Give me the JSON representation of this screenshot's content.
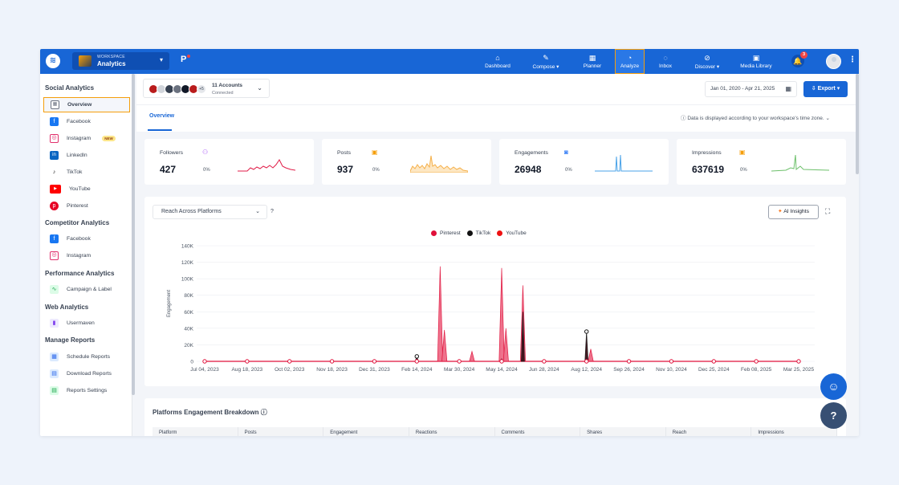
{
  "workspace": {
    "label": "WORKSPACE",
    "name": "Analytics"
  },
  "nav": [
    {
      "label": "Dashboard",
      "icon": "home-icon"
    },
    {
      "label": "Compose",
      "icon": "pen-icon"
    },
    {
      "label": "Planner",
      "icon": "calendar-icon"
    },
    {
      "label": "Analyze",
      "icon": "analyze-icon"
    },
    {
      "label": "Inbox",
      "icon": "chat-icon"
    },
    {
      "label": "Discover",
      "icon": "compass-icon"
    },
    {
      "label": "Media Library",
      "icon": "image-icon"
    }
  ],
  "notifications_count": "3",
  "sidebar": {
    "sections": [
      {
        "title": "Social Analytics",
        "items": [
          "Overview",
          "Facebook",
          "Instagram",
          "LinkedIn",
          "TikTok",
          "YouTube",
          "Pinterest"
        ]
      },
      {
        "title": "Competitor Analytics",
        "items": [
          "Facebook",
          "Instagram"
        ]
      },
      {
        "title": "Performance Analytics",
        "items": [
          "Campaign & Label"
        ]
      },
      {
        "title": "Web Analytics",
        "items": [
          "Usermaven"
        ]
      },
      {
        "title": "Manage Reports",
        "items": [
          "Schedule Reports",
          "Download Reports",
          "Reports Settings"
        ]
      }
    ],
    "new_badge": "NEW"
  },
  "accounts": {
    "count_label": "11 Accounts",
    "status": "Connected",
    "extra": "+5"
  },
  "date_range": "Jan 01, 2020 - Apr 21, 2025",
  "export_label": "Export",
  "tab": "Overview",
  "timezone_note": "Data is displayed according to your workspace's time zone.",
  "stats": [
    {
      "label": "Followers",
      "value": "427",
      "pct": "0%",
      "color": "#e11d48"
    },
    {
      "label": "Posts",
      "value": "937",
      "pct": "0%",
      "color": "#f5b04a"
    },
    {
      "label": "Engagements",
      "value": "26948",
      "pct": "0%",
      "color": "#4aa3e8"
    },
    {
      "label": "Impressions",
      "value": "637619",
      "pct": "0%",
      "color": "#6cc06a"
    }
  ],
  "chart_select": "Reach Across Platforms",
  "ai_insights": "AI Insights",
  "chart_data": {
    "type": "area",
    "ylabel": "Engagement",
    "ylim": [
      0,
      140000
    ],
    "yticks": [
      "0",
      "20K",
      "40K",
      "60K",
      "80K",
      "100K",
      "120K",
      "140K"
    ],
    "xticks": [
      "Jul 04, 2023",
      "Aug 18, 2023",
      "Oct 02, 2023",
      "Nov 18, 2023",
      "Dec 31, 2023",
      "Feb 14, 2024",
      "Mar 30, 2024",
      "May 14, 2024",
      "Jun 28, 2024",
      "Aug 12, 2024",
      "Sep 26, 2024",
      "Nov 10, 2024",
      "Dec 25, 2024",
      "Feb 08, 2025",
      "Mar 25, 2025"
    ],
    "series": [
      {
        "name": "Pinterest",
        "color": "#e0103a",
        "peaks": [
          [
            5.55,
            115000
          ],
          [
            5.65,
            38000
          ],
          [
            6.3,
            12000
          ],
          [
            7.0,
            113000
          ],
          [
            7.1,
            40000
          ],
          [
            7.5,
            92000
          ],
          [
            9.1,
            15000
          ]
        ]
      },
      {
        "name": "TikTok",
        "color": "#111111",
        "peaks": [
          [
            5.0,
            6000
          ],
          [
            7.0,
            3000
          ],
          [
            7.5,
            60000
          ],
          [
            9.0,
            36000
          ]
        ]
      },
      {
        "name": "YouTube",
        "color": "#ee1111",
        "peaks": []
      }
    ]
  },
  "breakdown": {
    "title": "Platforms Engagement Breakdown",
    "columns": [
      "Platform",
      "Posts",
      "Engagement",
      "Reactions",
      "Comments",
      "Shares",
      "Reach",
      "Impressions"
    ]
  }
}
